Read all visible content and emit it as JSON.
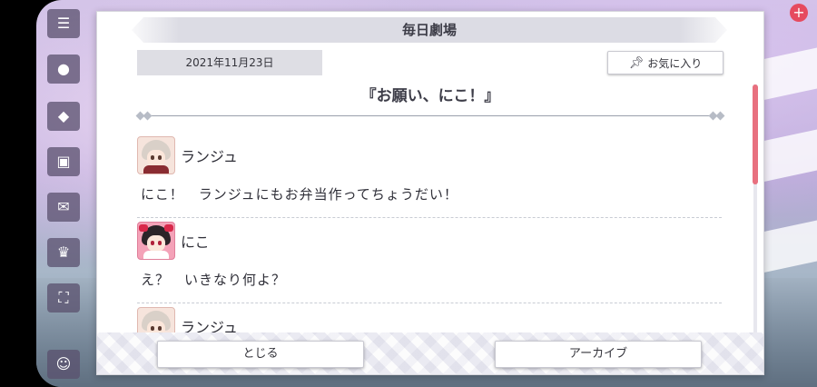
{
  "dialog": {
    "title": "毎日劇場",
    "date": "2021年11月23日",
    "favorite_label": "お気に入り",
    "story_title": "『お願い、にこ！』"
  },
  "dialogue": [
    {
      "speaker": "ランジュ",
      "text": "にこ！　ランジュにもお弁当作ってちょうだい！"
    },
    {
      "speaker": "にこ",
      "text": "え？　いきなり何よ？"
    },
    {
      "speaker": "ランジュ",
      "text": ""
    }
  ],
  "footer": {
    "close_label": "とじる",
    "archive_label": "アーカイブ"
  },
  "icons": {
    "favorite": "pin-icon",
    "corner_close": "plus-icon"
  },
  "colors": {
    "scroll_thumb": "#e8707f",
    "header_band": "#dcdce4",
    "date_box": "#dedee4"
  }
}
